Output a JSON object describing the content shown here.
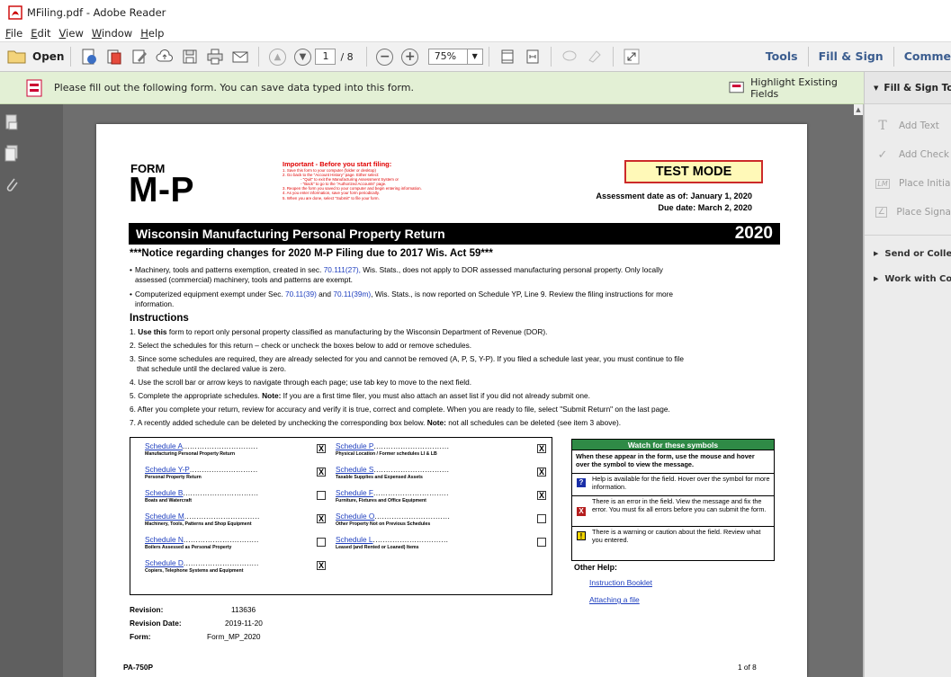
{
  "window": {
    "title": "MFiling.pdf - Adobe Reader"
  },
  "menu": [
    "File",
    "Edit",
    "View",
    "Window",
    "Help"
  ],
  "toolbar": {
    "open_label": "Open",
    "current_page": "1",
    "page_total": "/ 8",
    "zoom": "75%",
    "tabs": [
      "Tools",
      "Fill & Sign",
      "Comme"
    ]
  },
  "notify": {
    "message": "Please fill out the following form. You can save data typed into this form.",
    "highlight_label": "Highlight Existing Fields"
  },
  "rightpanel": {
    "header": "Fill & Sign To",
    "items": [
      {
        "icon": "text-icon",
        "label": "Add Text"
      },
      {
        "icon": "checkmark-icon",
        "label": "Add Check"
      },
      {
        "icon": "initials-icon",
        "label": "Place Initia"
      },
      {
        "icon": "signature-icon",
        "label": "Place Signa"
      }
    ],
    "sections": [
      "Send or Colle",
      "Work with Co"
    ]
  },
  "doc": {
    "form_label": "FORM",
    "form_name": "M-P",
    "important_title": "Important - Before you start filing:",
    "important_lines": [
      "1. Save this form to your computer (folder or desktop)",
      "2. Go back to the \"Account History\" page. Either select:",
      "- \"Quit\" to exit the Manufacturing Assessment System or",
      "- \"Back\" to go to the \"Authorized Accounts\" page.",
      "3. Reopen the form you saved to your computer and begin entering information.",
      "4. As you enter information, save your form periodically.",
      "5. When you are done, select \"Submit\" to file your form."
    ],
    "test_mode": "TEST MODE",
    "assessment_date": "Assessment date as of: January 1, 2020",
    "due_date": "Due date:  March 2, 2020",
    "band_title": "Wisconsin Manufacturing Personal Property Return",
    "band_year": "2020",
    "notice": "***Notice regarding changes for 2020 M-P Filing due to 2017 Wis. Act 59***",
    "bullet1_a": "Machinery, tools and patterns exemption, created in sec. ",
    "bullet1_link": "70.111(27),",
    "bullet1_b": " Wis. Stats., does not apply to DOR assessed manufacturing personal property. Only locally",
    "bullet1_c": "assessed (commercial) machinery, tools and patterns are exempt.",
    "bullet2_a": "Computerized equipment exempt under Sec. ",
    "bullet2_link1": "70.11(39)",
    "bullet2_b": " and ",
    "bullet2_link2": "70.11(39m)",
    "bullet2_c": ", Wis. Stats., is now reported on Schedule YP, Line 9. Review the filing instructions for more",
    "bullet2_d": "information.",
    "instructions_header": "Instructions",
    "instr1_bold": "Use this",
    "instr1_rest": " form to report only personal property classified as manufacturing by the Wisconsin Department of Revenue (DOR).",
    "instr2": "2. Select the schedules for this return –  check or uncheck the boxes below to add or remove schedules.",
    "instr3a": "3. Since some schedules are required, they are already selected for you and cannot be removed (A, P, S, Y-P). If you filed a schedule last year, you must continue to file",
    "instr3b": "that schedule until the declared value is zero.",
    "instr4": "4. Use the scroll bar or arrow keys to navigate through each page; use tab key to move to the next field.",
    "instr5a": "5. Complete the appropriate schedules. ",
    "instr5_note": "Note:",
    "instr5b": " If you are a first time filer, you must also attach an asset list if you did not already submit one.",
    "instr6": "6. After you complete your return, review for accuracy and verify it is true, correct and complete. When you are ready to file, select \"Submit Return\" on the last page.",
    "instr7a": "7. A recently added schedule can be deleted by unchecking the corresponding box below. ",
    "instr7_note": "Note:",
    "instr7b": " not all schedules can be deleted (see item 3 above).",
    "schedules_left": [
      {
        "name": "Schedule A",
        "desc": "Manufacturing Personal Property Return",
        "checked": "X"
      },
      {
        "name": "Schedule Y-P",
        "desc": "Personal Property Return",
        "checked": "X"
      },
      {
        "name": "Schedule B",
        "desc": "Boats and Watercraft",
        "checked": ""
      },
      {
        "name": "Schedule M",
        "desc": "Machinery, Tools, Patterns and Shop Equipment",
        "checked": "X"
      },
      {
        "name": "Schedule N",
        "desc": "Boilers Assessed as Personal Property",
        "checked": ""
      },
      {
        "name": "Schedule D",
        "desc": "Copiers, Telephone Systems and Equipment",
        "checked": "X"
      }
    ],
    "schedules_right": [
      {
        "name": "Schedule P",
        "desc": "Physical Location / Former schedules LI & LB",
        "checked": "X"
      },
      {
        "name": "Schedule S",
        "desc": "Taxable Supplies and Expensed Assets",
        "checked": "X"
      },
      {
        "name": "Schedule F",
        "desc": "Furniture, Fixtures and Office Equipment",
        "checked": "X"
      },
      {
        "name": "Schedule O",
        "desc": "Other Property Not on Previous Schedules",
        "checked": ""
      },
      {
        "name": "Schedule L",
        "desc": "Leased (and Rented or Loaned) Items",
        "checked": ""
      }
    ],
    "watch_title": "Watch for these symbols",
    "watch_intro": "When these appear in the form, use the mouse and hover over the symbol to view the message.",
    "watch_rows": [
      {
        "symbol": "?",
        "color": "#1a2fa8",
        "text": "Help is available for the field. Hover over the symbol for more information."
      },
      {
        "symbol": "X",
        "color": "#b51e1e",
        "text": "There is an error in the field.  View the message and fix the error.  You must fix all errors before you can submit the form."
      },
      {
        "symbol": "!",
        "color": "#f2d400",
        "text": "There is a warning or caution about the field. Review what you entered."
      }
    ],
    "other_help": "Other Help:",
    "help_links": [
      "Instruction Booklet",
      "Attaching a file"
    ],
    "revision_label": "Revision:",
    "revision_value": "113636",
    "revdate_label": "Revision Date:",
    "revdate_value": "2019-11-20",
    "form_field_label": "Form:",
    "form_field_value": "Form_MP_2020",
    "pa_code": "PA-750P",
    "page_of": "1 of 8"
  }
}
